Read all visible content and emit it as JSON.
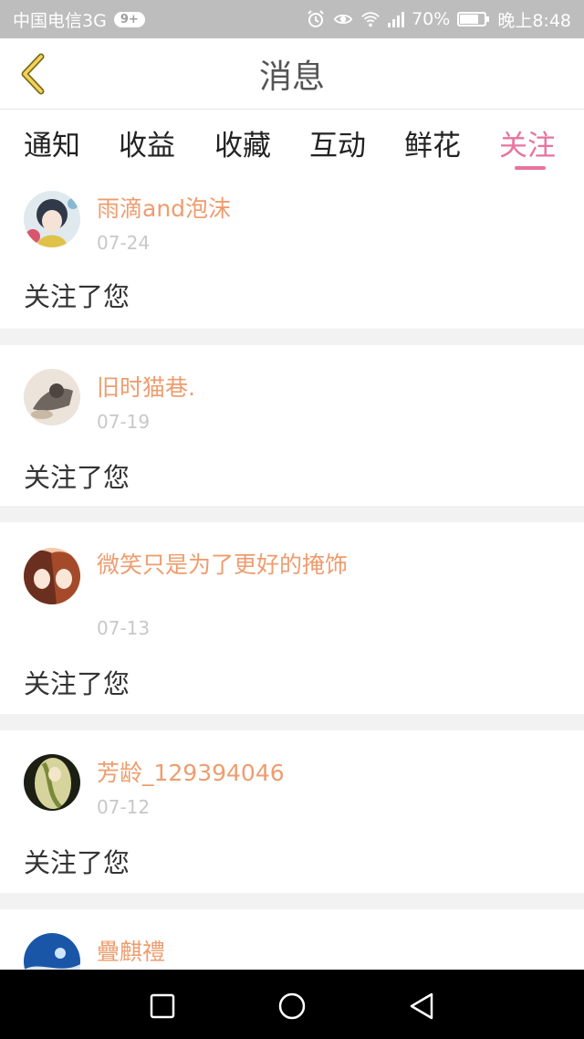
{
  "status_bar": {
    "carrier": "中国电信3G",
    "badge": "9+",
    "network": "3G",
    "battery": "70%",
    "battery_level": 0.7,
    "time": "晚上8:48",
    "icons": [
      "alarm-icon",
      "eye-icon",
      "wifi-icon",
      "signal-icon",
      "battery-icon"
    ]
  },
  "header": {
    "title": "消息",
    "back_icon": "chevron-left-icon"
  },
  "tabs": [
    {
      "label": "通知",
      "active": false
    },
    {
      "label": "收益",
      "active": false
    },
    {
      "label": "收藏",
      "active": false
    },
    {
      "label": "互动",
      "active": false
    },
    {
      "label": "鲜花",
      "active": false
    },
    {
      "label": "关注",
      "active": true
    }
  ],
  "messages": [
    {
      "username": "雨滴and泡沫",
      "date": "07-24",
      "text": "关注了您"
    },
    {
      "username": "旧时猫巷.",
      "date": "07-19",
      "text": "关注了您"
    },
    {
      "username": "微笑只是为了更好的掩饰",
      "date": "07-13",
      "text": "关注了您"
    },
    {
      "username": "芳龄_129394046",
      "date": "07-12",
      "text": "关注了您"
    },
    {
      "username": "疊麒禮",
      "date": "",
      "text": ""
    }
  ],
  "nav_bar": {
    "icons": [
      "square-icon",
      "circle-icon",
      "triangle-back-icon"
    ]
  },
  "colors": {
    "accent": "#e8739e",
    "username": "#ee9d6f",
    "date": "#c8c8c8"
  }
}
